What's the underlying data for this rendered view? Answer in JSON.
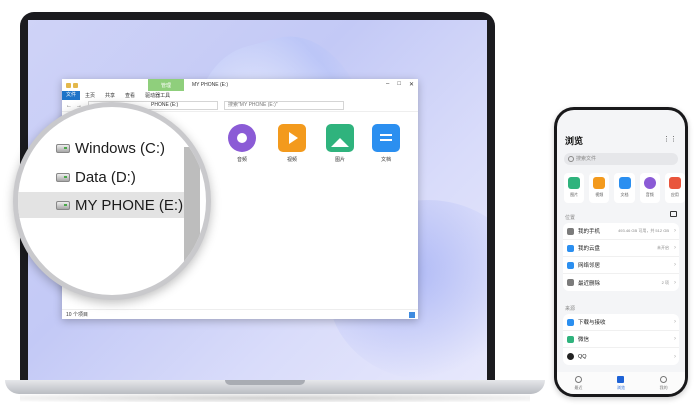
{
  "explorer": {
    "manage_tab": "管理",
    "window_title": "MY PHONE (E:)",
    "ribbon_tabs": [
      "文件",
      "主页",
      "共享",
      "查看",
      "驱动器工具"
    ],
    "address": "PHONE (E:)",
    "search_placeholder": "搜索\"MY PHONE (E:)\"",
    "files": [
      {
        "label": "音频",
        "color": "#8b5bd6"
      },
      {
        "label": "视频",
        "color": "#f39a1d"
      },
      {
        "label": "图片",
        "color": "#2fb37d"
      },
      {
        "label": "文档",
        "color": "#2b8ff0"
      }
    ],
    "status": "10 个项目"
  },
  "magnifier": {
    "drives": [
      {
        "label": "Windows (C:)"
      },
      {
        "label": "Data (D:)"
      },
      {
        "label": "MY PHONE (E:)"
      }
    ]
  },
  "phone": {
    "title": "浏览",
    "header_icons": "⋮⋮",
    "search_placeholder": "搜索文件",
    "categories": [
      {
        "label": "图片",
        "color": "#2fb37d"
      },
      {
        "label": "视频",
        "color": "#f39a1d"
      },
      {
        "label": "文档",
        "color": "#2b8ff0"
      },
      {
        "label": "音频",
        "color": "#8b5bd6"
      },
      {
        "label": "应用",
        "color": "#e9553c"
      }
    ],
    "location_section": "位置",
    "locations": [
      {
        "label": "我的手机",
        "value": "493.46 GB 可用，共 512 GB",
        "color": "#7b7b7b"
      },
      {
        "label": "我的云盘",
        "value": "未开启",
        "color": "#2b8ff0"
      },
      {
        "label": "网络邻居",
        "value": "",
        "color": "#2b8ff0"
      },
      {
        "label": "最近删除",
        "value": "2 项",
        "color": "#7b7b7b"
      }
    ],
    "source_section": "来源",
    "sources": [
      {
        "label": "下载与接收",
        "color": "#2b8ff0"
      },
      {
        "label": "微信",
        "color": "#2fb37d"
      },
      {
        "label": "QQ",
        "color": "#222222"
      }
    ],
    "tabs": [
      {
        "label": "最近",
        "active": false
      },
      {
        "label": "浏览",
        "active": true
      },
      {
        "label": "我的",
        "active": false
      }
    ]
  }
}
